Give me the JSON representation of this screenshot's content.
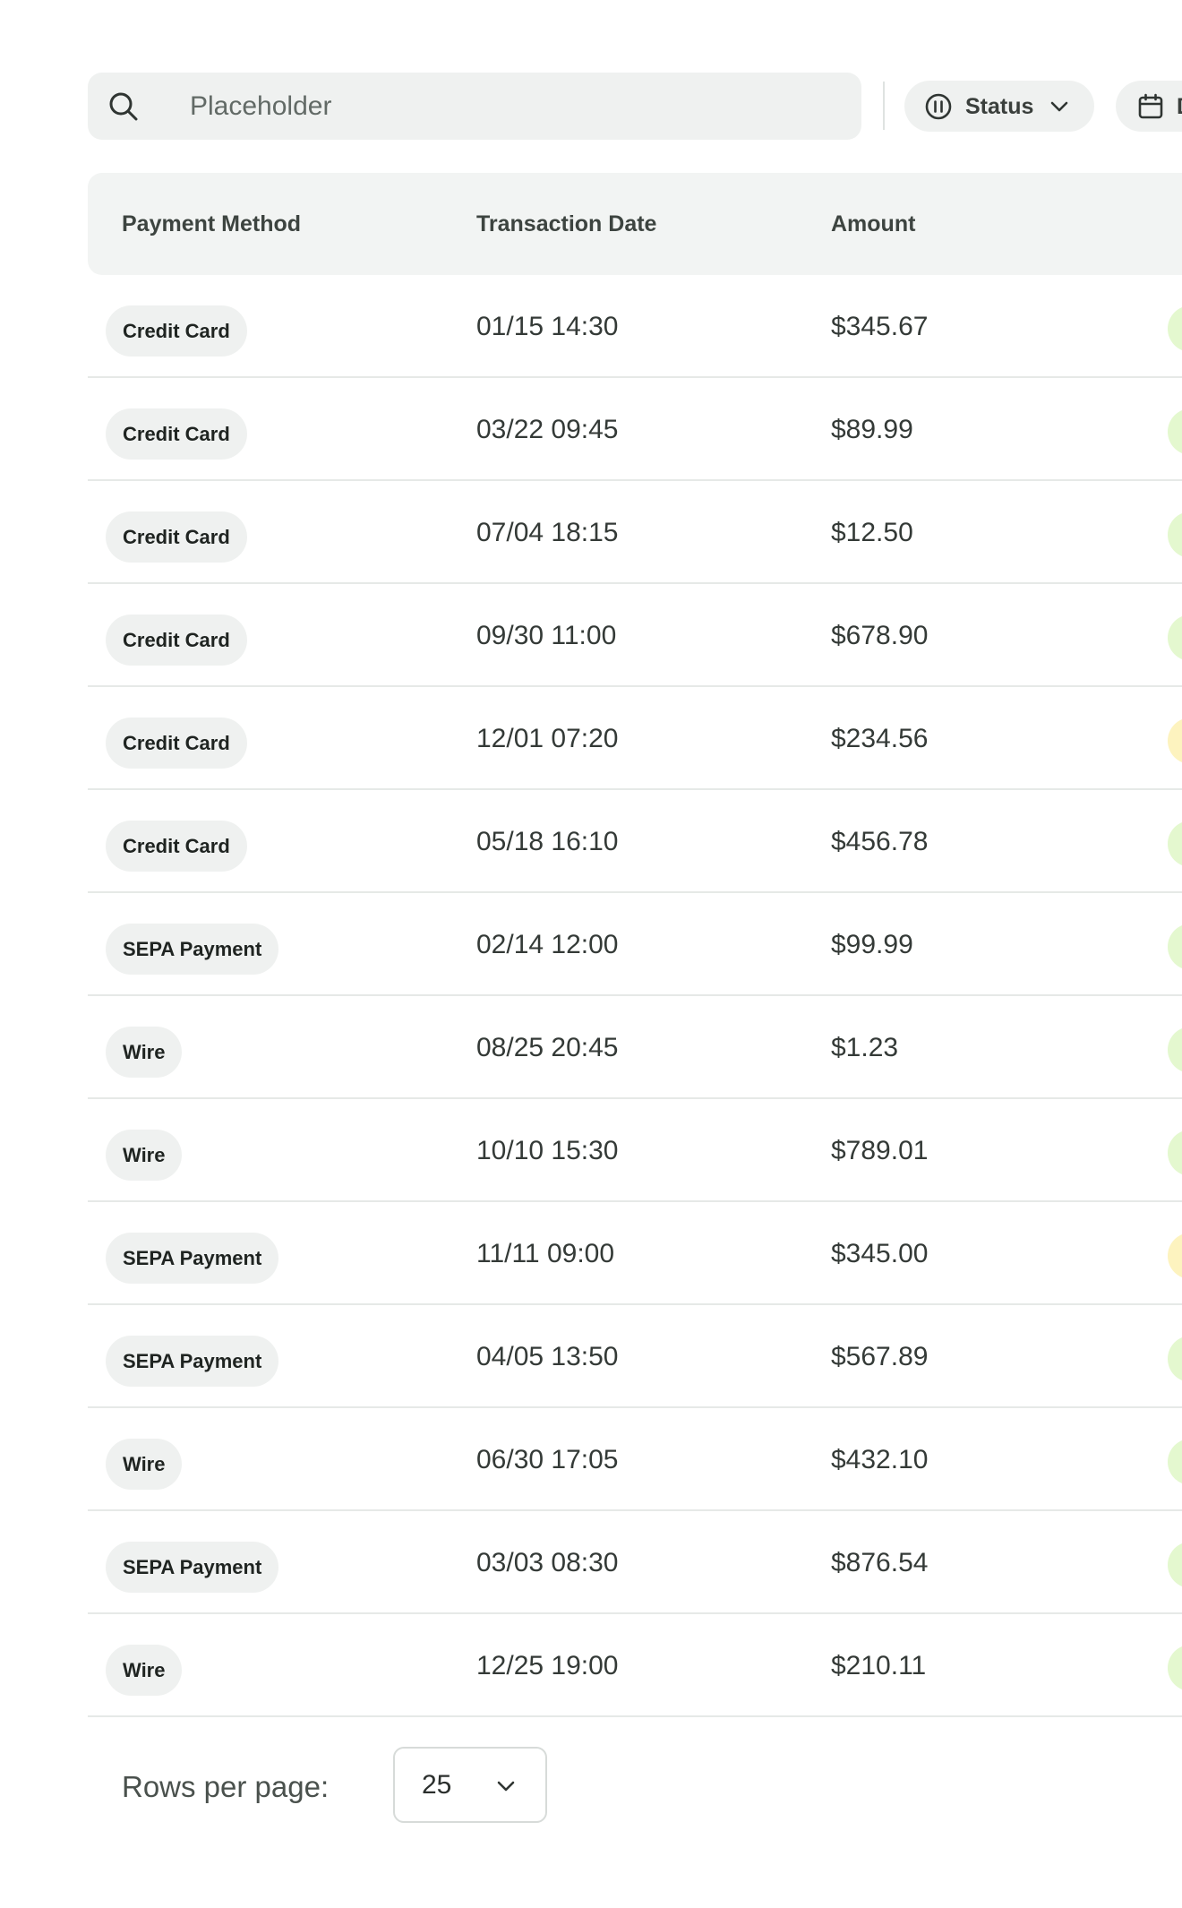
{
  "search": {
    "placeholder": "Placeholder",
    "value": ""
  },
  "filters": {
    "status_label": "Status",
    "date_label": "D"
  },
  "table": {
    "columns": [
      "Payment Method",
      "Transaction Date",
      "Amount"
    ],
    "rows": [
      {
        "method": "Credit Card",
        "date": "01/15 14:30",
        "amount": "$345.67",
        "status_color": "#e4f8cf"
      },
      {
        "method": "Credit Card",
        "date": "03/22 09:45",
        "amount": "$89.99",
        "status_color": "#e4f8cf"
      },
      {
        "method": "Credit Card",
        "date": "07/04 18:15",
        "amount": "$12.50",
        "status_color": "#e4f8cf"
      },
      {
        "method": "Credit Card",
        "date": "09/30 11:00",
        "amount": "$678.90",
        "status_color": "#e4f8cf"
      },
      {
        "method": "Credit Card",
        "date": "12/01 07:20",
        "amount": "$234.56",
        "status_color": "#fdf3bf"
      },
      {
        "method": "Credit Card",
        "date": "05/18 16:10",
        "amount": "$456.78",
        "status_color": "#e4f8cf"
      },
      {
        "method": "SEPA Payment",
        "date": "02/14 12:00",
        "amount": "$99.99",
        "status_color": "#e4f8cf"
      },
      {
        "method": "Wire",
        "date": "08/25 20:45",
        "amount": "$1.23",
        "status_color": "#e4f8cf"
      },
      {
        "method": "Wire",
        "date": "10/10 15:30",
        "amount": "$789.01",
        "status_color": "#e4f8cf"
      },
      {
        "method": "SEPA Payment",
        "date": "11/11 09:00",
        "amount": "$345.00",
        "status_color": "#fdf3bf"
      },
      {
        "method": "SEPA Payment",
        "date": "04/05 13:50",
        "amount": "$567.89",
        "status_color": "#e4f8cf"
      },
      {
        "method": "Wire",
        "date": "06/30 17:05",
        "amount": "$432.10",
        "status_color": "#e4f8cf"
      },
      {
        "method": "SEPA Payment",
        "date": "03/03 08:30",
        "amount": "$876.54",
        "status_color": "#e4f8cf"
      },
      {
        "method": "Wire",
        "date": "12/25 19:00",
        "amount": "$210.11",
        "status_color": "#e4f8cf"
      }
    ]
  },
  "pagination": {
    "rows_per_page_label": "Rows per page:",
    "rows_per_page_value": "25"
  },
  "icons": {
    "search": "search-icon",
    "status": "pause-circle-icon",
    "chevron": "chevron-down-icon",
    "date": "calendar-icon"
  },
  "colors": {
    "surface": "#eff1f0",
    "status_success": "#e4f8cf",
    "status_pending": "#fdf3bf"
  }
}
